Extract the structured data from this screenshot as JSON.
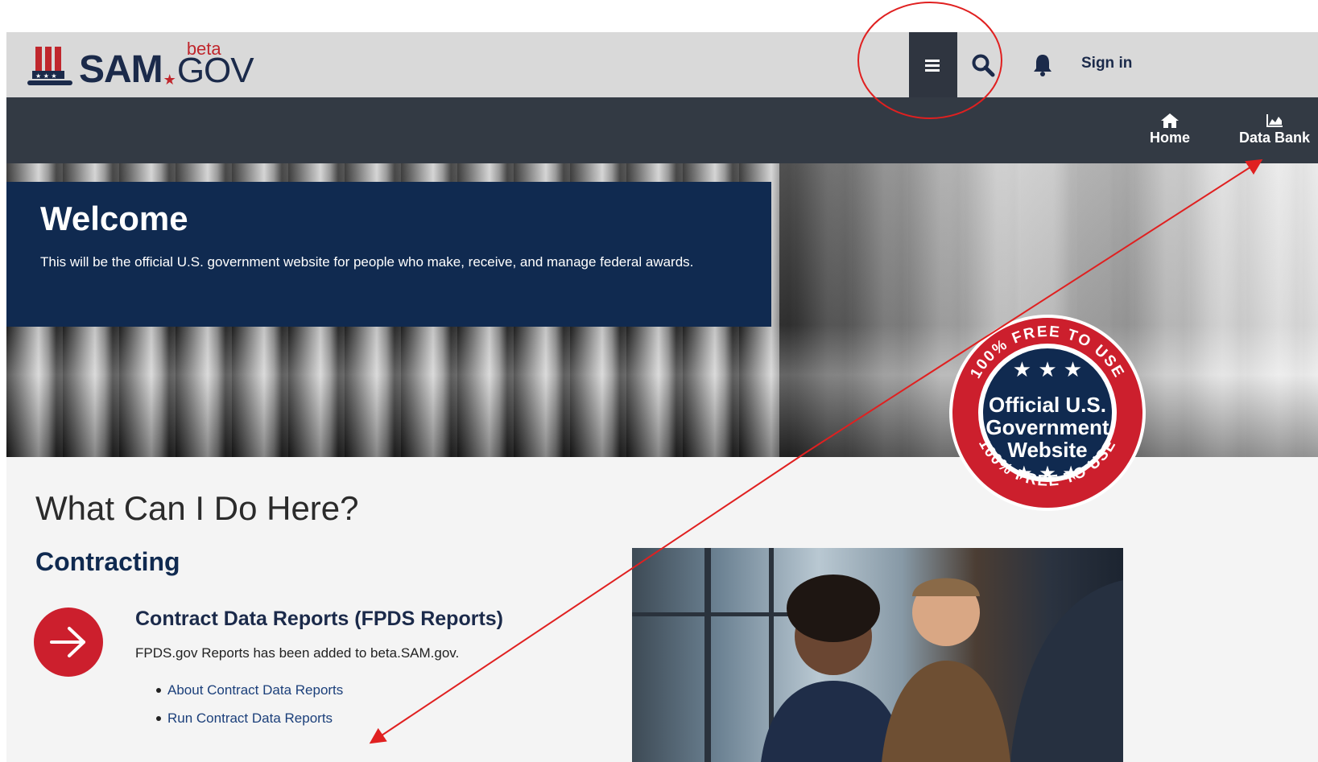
{
  "header": {
    "logo_text": "SAM",
    "logo_beta": "beta",
    "logo_gov": "GOV",
    "sign_in": "Sign in"
  },
  "nav": {
    "items": [
      {
        "label": "Home",
        "icon": "home-icon"
      },
      {
        "label": "Data Bank",
        "icon": "chart-icon"
      }
    ]
  },
  "hero": {
    "title": "Welcome",
    "description": "This will be the official U.S. government website for people who make, receive, and manage federal awards.",
    "badge": {
      "top_text": "100% FREE TO USE",
      "line1": "Official U.S.",
      "line2": "Government",
      "line3": "Website",
      "bottom_text": "100% FREE TO USE"
    }
  },
  "main": {
    "heading": "What Can I Do Here?",
    "section": "Contracting",
    "card": {
      "title": "Contract Data Reports (FPDS Reports)",
      "description": "FPDS.gov Reports has been added to beta.SAM.gov.",
      "links": [
        "About Contract Data Reports",
        "Run Contract Data Reports"
      ]
    }
  },
  "colors": {
    "navy": "#102a50",
    "header_gray": "#d9d9d9",
    "nav_dark": "#333a44",
    "accent_red": "#cc1f2d",
    "annotation_red": "#e02020"
  }
}
